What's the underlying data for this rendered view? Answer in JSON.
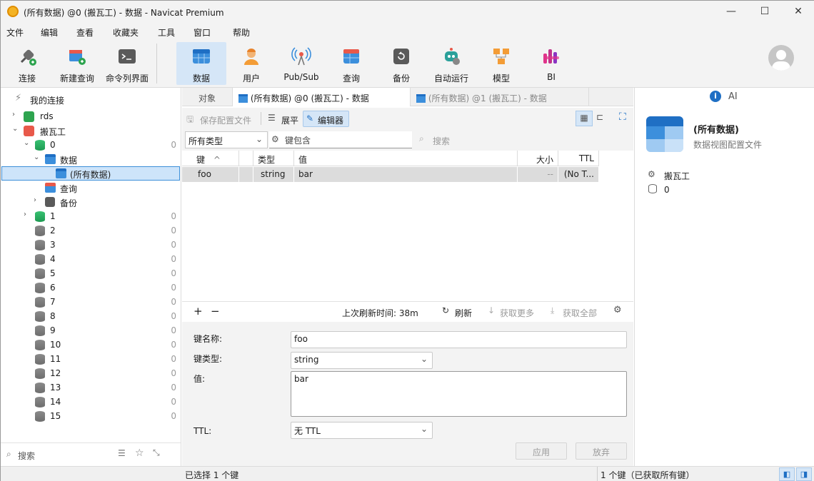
{
  "window": {
    "title": "(所有数据) @0 (搬瓦工) - 数据 - Navicat Premium",
    "minimize": "—",
    "maximize": "☐",
    "close": "✕"
  },
  "menu": [
    "文件",
    "编辑",
    "查看",
    "收藏夹",
    "工具",
    "窗口",
    "帮助"
  ],
  "toolbar": [
    {
      "label": "连接",
      "icon": "connect-plug-icon"
    },
    {
      "label": "新建查询",
      "icon": "new-query-icon"
    },
    {
      "label": "命令列界面",
      "icon": "terminal-icon"
    },
    {
      "label": "数据",
      "icon": "data-table-icon",
      "active": true
    },
    {
      "label": "用户",
      "icon": "user-icon"
    },
    {
      "label": "Pub/Sub",
      "icon": "broadcast-icon"
    },
    {
      "label": "查询",
      "icon": "query-icon"
    },
    {
      "label": "备份",
      "icon": "backup-icon"
    },
    {
      "label": "自动运行",
      "icon": "robot-icon"
    },
    {
      "label": "模型",
      "icon": "model-icon"
    },
    {
      "label": "BI",
      "icon": "bi-chart-icon"
    }
  ],
  "tree": {
    "header": "我的连接",
    "rds": "rds",
    "server": "搬瓦工",
    "db0": "0",
    "db0_count": "0",
    "data_node": "数据",
    "selected_item": "(所有数据)",
    "query_node": "查询",
    "backup_node": "备份",
    "dbs": [
      {
        "name": "1",
        "count": "0"
      },
      {
        "name": "2",
        "count": "0"
      },
      {
        "name": "3",
        "count": "0"
      },
      {
        "name": "4",
        "count": "0"
      },
      {
        "name": "5",
        "count": "0"
      },
      {
        "name": "6",
        "count": "0"
      },
      {
        "name": "7",
        "count": "0"
      },
      {
        "name": "8",
        "count": "0"
      },
      {
        "name": "9",
        "count": "0"
      },
      {
        "name": "10",
        "count": "0"
      },
      {
        "name": "11",
        "count": "0"
      },
      {
        "name": "12",
        "count": "0"
      },
      {
        "name": "13",
        "count": "0"
      },
      {
        "name": "14",
        "count": "0"
      },
      {
        "name": "15",
        "count": "0"
      }
    ],
    "search_placeholder": "搜索"
  },
  "tabs": {
    "objects": "对象",
    "tab1": "(所有数据) @0 (搬瓦工) - 数据",
    "tab2": "(所有数据) @1 (搬瓦工) - 数据"
  },
  "subbar": {
    "save_profile": "保存配置文件",
    "flat": "展平",
    "editor": "编辑器"
  },
  "filter": {
    "type_value": "所有类型",
    "key_contains": "键包含",
    "search": "搜索"
  },
  "grid": {
    "headers": {
      "key": "键",
      "sort": "^",
      "type": "类型",
      "value": "值",
      "size": "大小",
      "ttl": "TTL"
    },
    "rows": [
      {
        "key": "foo",
        "type": "string",
        "value": "bar",
        "size": "--",
        "ttl": "(No T..."
      }
    ]
  },
  "midfoot": {
    "add": "+",
    "remove": "−",
    "last_refresh": "上次刷新时间: 38m",
    "refresh": "刷新",
    "fetch_more": "获取更多",
    "fetch_all": "获取全部"
  },
  "form": {
    "key_name_label": "键名称:",
    "key_name_value": "foo",
    "key_type_label": "键类型:",
    "key_type_value": "string",
    "value_label": "值:",
    "value_value": "bar",
    "ttl_label": "TTL:",
    "ttl_value": "无 TTL",
    "apply": "应用",
    "discard": "放弃"
  },
  "right": {
    "ai": "AI",
    "title": "(所有数据)",
    "subtitle": "数据视图配置文件",
    "server": "搬瓦工",
    "db": "0"
  },
  "status": {
    "left": "已选择 1 个键",
    "right": "1 个键（已获取所有键）"
  }
}
